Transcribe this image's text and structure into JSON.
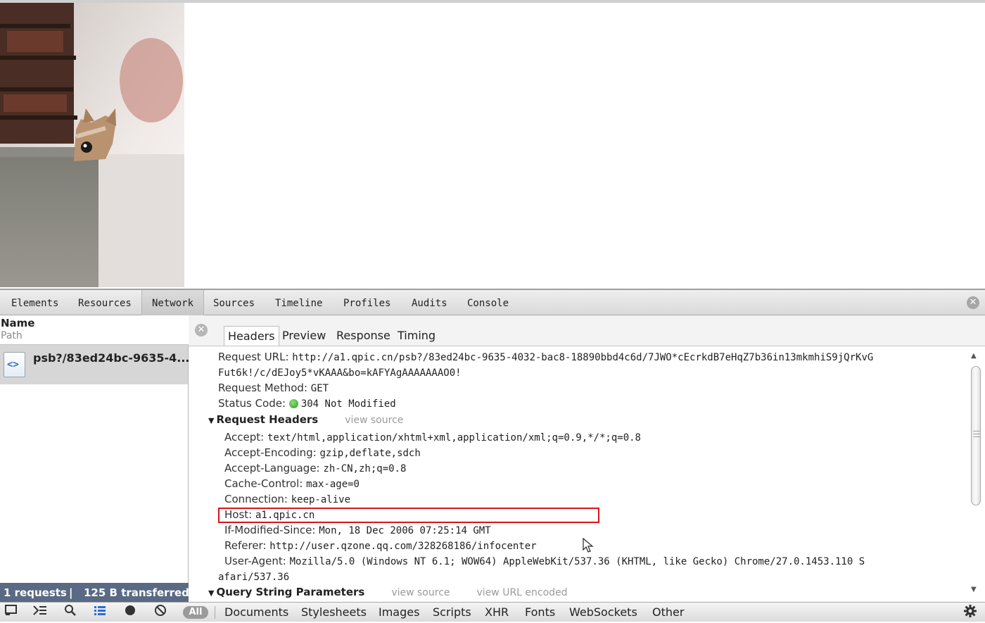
{
  "devtools": {
    "panel_tabs": [
      "Elements",
      "Resources",
      "Network",
      "Sources",
      "Timeline",
      "Profiles",
      "Audits",
      "Console"
    ],
    "active_panel": "Network"
  },
  "request_list": {
    "col_name": "Name",
    "col_path": "Path",
    "items": [
      {
        "name": "psb?/83ed24bc-9635-4..."
      }
    ],
    "summary_requests": "1 requests",
    "summary_sep": "|",
    "summary_transferred": "125 B transferred"
  },
  "detail": {
    "tabs": [
      "Headers",
      "Preview",
      "Response",
      "Timing"
    ],
    "active_tab": "Headers",
    "request_url_label": "Request URL:",
    "request_url_1": "http://a1.qpic.cn/psb?/83ed24bc-9635-4032-bac8-18890bbd4c6d/7JWO*cEcrkdB7eHqZ7b36in13mkmhiS9jQrKvG",
    "request_url_2": "Fut6k!/c/dEJoy5*vKAAA&bo=kAFYAgAAAAAAAO0!",
    "method_label": "Request Method:",
    "method_value": "GET",
    "status_label": "Status Code:",
    "status_value": "304 Not Modified",
    "status_color": "#3aa52c",
    "request_headers_title": "Request Headers",
    "view_source": "view source",
    "headers": [
      {
        "key": "Accept:",
        "value": "text/html,application/xhtml+xml,application/xml;q=0.9,*/*;q=0.8"
      },
      {
        "key": "Accept-Encoding:",
        "value": "gzip,deflate,sdch"
      },
      {
        "key": "Accept-Language:",
        "value": "zh-CN,zh;q=0.8"
      },
      {
        "key": "Cache-Control:",
        "value": "max-age=0"
      },
      {
        "key": "Connection:",
        "value": "keep-alive"
      },
      {
        "key": "Host:",
        "value": "a1.qpic.cn"
      },
      {
        "key": "If-Modified-Since:",
        "value": "Mon, 18 Dec 2006 07:25:14 GMT"
      },
      {
        "key": "Referer:",
        "value": "http://user.qzone.qq.com/328268186/infocenter"
      },
      {
        "key": "User-Agent:",
        "value": "Mozilla/5.0 (Windows NT 6.1; WOW64) AppleWebKit/537.36 (KHTML, like Gecko) Chrome/27.0.1453.110 S"
      }
    ],
    "user_agent_cont": "afari/537.36",
    "query_title": "Query String Parameters",
    "query_view_source": "view source",
    "query_view_url_encoded": "view URL encoded"
  },
  "bottombar": {
    "filter_all": "All",
    "filters": [
      "Documents",
      "Stylesheets",
      "Images",
      "Scripts",
      "XHR",
      "Fonts",
      "WebSockets",
      "Other"
    ]
  },
  "icons": {
    "dock": "dock-icon",
    "console": "console-drawer-icon",
    "search": "search-icon",
    "list": "list-view-icon",
    "record": "record-icon",
    "clear": "clear-icon",
    "settings": "gear-icon",
    "close": "close-icon"
  },
  "colors": {
    "summary_bg": "#5a6a84",
    "highlight": "#d9141b"
  }
}
